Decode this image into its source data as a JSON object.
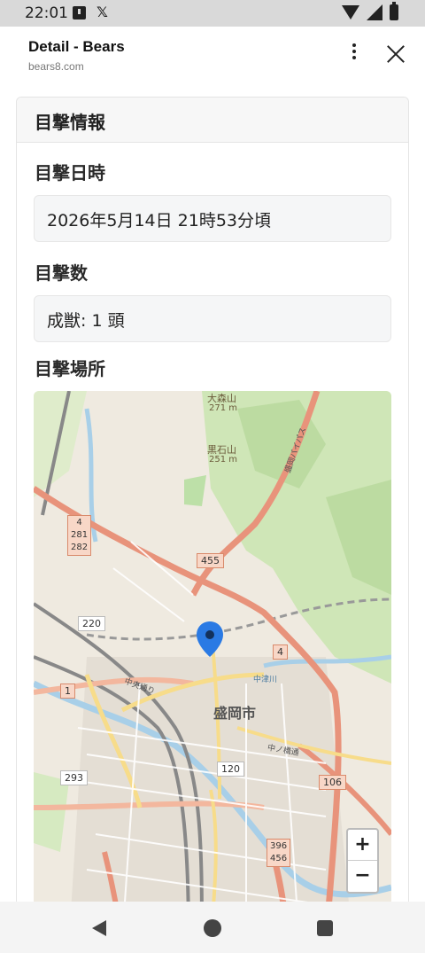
{
  "status": {
    "time": "22:01",
    "x_label": "𝕏"
  },
  "browser": {
    "title": "Detail - Bears",
    "url": "bears8.com"
  },
  "card": {
    "header": "目撃情報",
    "datetime_label": "目撃日時",
    "datetime_value": "2026年5月14日 21時53分頃",
    "count_label": "目撃数",
    "count_value": "成獣: 1 頭",
    "location_label": "目撃場所"
  },
  "map": {
    "labels": {
      "mountain1": "大森山",
      "mountain1_height": "271 m",
      "mountain2": "黒石山",
      "mountain2_height": "251 m",
      "city": "盛岡市",
      "route_4a": "4",
      "route_281": "281",
      "route_282": "282",
      "route_455": "455",
      "route_220": "220",
      "route_4b": "4",
      "route_1": "1",
      "route_293": "293",
      "route_120": "120",
      "route_106": "106",
      "route_396": "396",
      "route_456": "456",
      "street1": "中央通り",
      "street2": "中ノ橋通",
      "river": "中津川",
      "bypass": "盛岡バイパス"
    },
    "zoom_in": "+",
    "zoom_out": "−"
  },
  "colors": {
    "marker": "#2a7ae4",
    "main_road": "#e8937b",
    "secondary_road": "#f7dc8a"
  }
}
